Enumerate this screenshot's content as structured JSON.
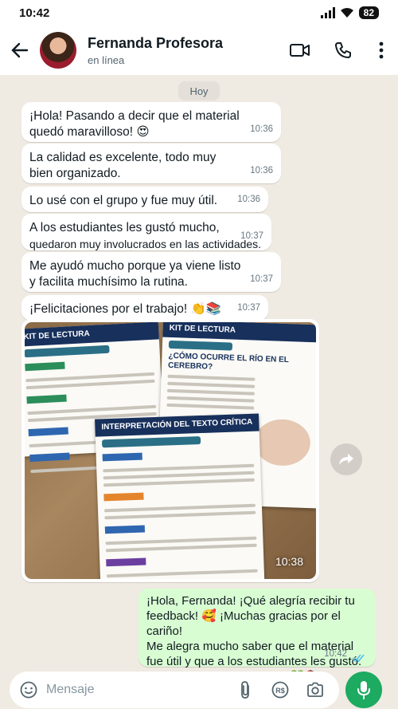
{
  "status_bar": {
    "time": "10:42",
    "battery": "82"
  },
  "header": {
    "contact_name": "Fernanda Profesora",
    "contact_status": "en línea"
  },
  "chat": {
    "date_chip": "Hoy",
    "incoming": [
      {
        "lines": [
          "¡Hola! Pasando a decir que el material",
          "quedó maravilloso! 😍"
        ],
        "time": "10:36"
      },
      {
        "lines": [
          "La calidad es excelente, todo muy",
          "bien organizado."
        ],
        "time": "10:36"
      },
      {
        "lines": [
          "Lo usé con el grupo y fue muy útil."
        ],
        "time": "10:36"
      },
      {
        "lines": [
          "A los estudiantes les gustó mucho,",
          "quedaron muy involucrados en las actividades."
        ],
        "time": "10:37"
      },
      {
        "lines": [
          "Me ayudó mucho porque ya viene listo",
          "y facilita muchísimo la rutina."
        ],
        "time": "10:37"
      },
      {
        "lines": [
          "¡Felicitaciones por el trabajo! 👏📚"
        ],
        "time": "10:37"
      }
    ],
    "photo": {
      "time": "10:38",
      "sheets": {
        "left_title": "KIT DE LECTURA",
        "right_title": "KIT DE LECTURA",
        "right_heading": "¿CÓMO OCURRE EL RÍO EN EL CEREBRO?",
        "front_title": "INTERPRETACIÓN DEL TEXTO CRÍTICA"
      }
    },
    "outgoing": {
      "lines": [
        "¡Hola, Fernanda! ¡Qué alegría recibir tu",
        "feedback! 🥰 ¡Muchas gracias por el cariño!",
        "Me alegra mucho saber que el material",
        "fue útil y que a los estudiantes les gustó.",
        "¡Cuenta conmigo siempre! 💚📚"
      ],
      "time": "10:42"
    }
  },
  "composer": {
    "placeholder": "Mensaje"
  },
  "colors": {
    "accent_green": "#1daa61",
    "outgoing_bubble": "#d9fdd3",
    "read_ticks": "#53bdeb"
  },
  "icons": [
    "back-arrow-icon",
    "video-call-icon",
    "phone-icon",
    "more-options-icon",
    "forward-icon",
    "emoji-icon",
    "attach-icon",
    "payment-icon",
    "camera-icon",
    "mic-icon",
    "read-ticks-icon"
  ]
}
